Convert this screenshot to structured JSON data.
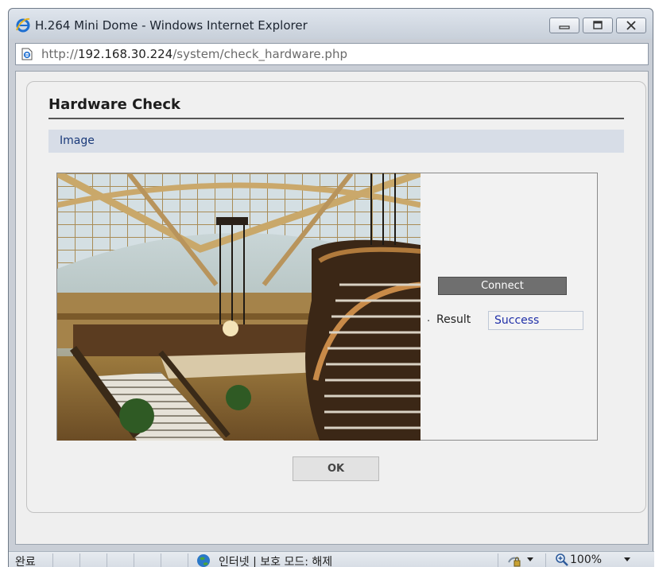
{
  "window": {
    "title": "H.264 Mini Dome - Windows Internet Explorer",
    "url_prefix": "http://",
    "url_host": "192.168.30.224",
    "url_path": "/system/check_hardware.php"
  },
  "page": {
    "title": "Hardware Check",
    "section_label": "Image",
    "connect_label": "Connect",
    "result_label": "Result",
    "result_value": "Success",
    "ok_label": "OK"
  },
  "statusbar": {
    "status_text": "완료",
    "zone_text": "인터넷 | 보호 모드: 해제",
    "zoom_text": "100%"
  },
  "colors": {
    "section_bg": "#d7dde7",
    "connect_bg": "#6f6f6f",
    "result_text": "#1f2fa8"
  }
}
